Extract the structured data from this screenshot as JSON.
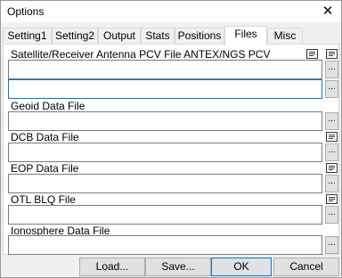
{
  "window": {
    "title": "Options",
    "close_glyph": "✕"
  },
  "tabs": [
    {
      "label": "Setting1",
      "active": false
    },
    {
      "label": "Setting2",
      "active": false
    },
    {
      "label": "Output",
      "active": false
    },
    {
      "label": "Stats",
      "active": false
    },
    {
      "label": "Positions",
      "active": false
    },
    {
      "label": "Files",
      "active": true
    },
    {
      "label": "Misc",
      "active": false
    }
  ],
  "files": {
    "antenna_label": "Satellite/Receiver Antenna PCV File ANTEX/NGS PCV",
    "antenna_sat_value": "",
    "antenna_rcv_value": "",
    "geoid_label": "Geoid Data File",
    "geoid_value": "",
    "dcb_label": "DCB Data File",
    "dcb_value": "",
    "eop_label": "EOP Data File",
    "eop_value": "",
    "blq_label": "OTL BLQ File",
    "blq_value": "",
    "iono_label": "Ionosphere Data File",
    "iono_value": "",
    "browse_label": "...",
    "view_icon": "file-view-icon"
  },
  "buttons": {
    "load": "Load...",
    "save": "Save...",
    "ok": "OK",
    "cancel": "Cancel"
  },
  "colors": {
    "focus_border": "#0078d7",
    "panel_bg": "#ffffff",
    "window_bg": "#f0f0f0"
  }
}
